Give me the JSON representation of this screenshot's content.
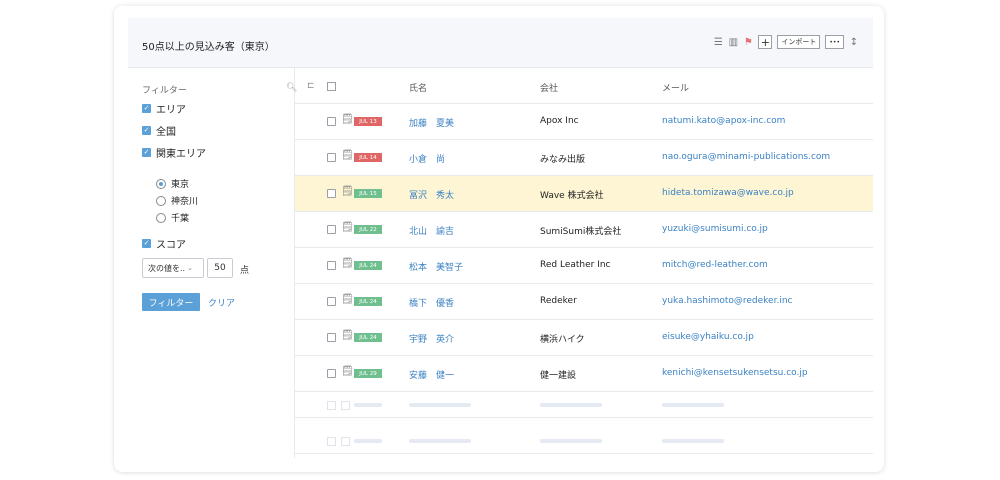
{
  "header": {
    "title": "50点以上の見込み客（東京）",
    "import_label": "インポート",
    "more_label": "•••",
    "add_label": "+",
    "sort_label": "↕"
  },
  "sidebar": {
    "title": "フィルター",
    "checkboxes": [
      "エリア",
      "全国",
      "関東エリア"
    ],
    "radios": [
      {
        "label": "東京",
        "selected": true
      },
      {
        "label": "神奈川",
        "selected": false
      },
      {
        "label": "千葉",
        "selected": false
      }
    ],
    "score_label": "スコア",
    "select_value": "次の値を..",
    "score_value": "50",
    "score_unit": "点",
    "filter_button": "フィルター",
    "clear_link": "クリア"
  },
  "table": {
    "columns": {
      "name": "氏名",
      "company": "会社",
      "email": "メール"
    },
    "rows": [
      {
        "tag": "JUL 13",
        "tag_color": "red",
        "name": "加藤　夏美",
        "company": "Apox Inc",
        "email": "natumi.kato@apox-inc.com"
      },
      {
        "tag": "JUL 14",
        "tag_color": "red",
        "name": "小倉　尚",
        "company": "みなみ出版",
        "email": "nao.ogura@minami-publications.com"
      },
      {
        "tag": "JUL 15",
        "tag_color": "green",
        "name": "冨沢　秀太",
        "company": "Wave 株式会社",
        "email": "hideta.tomizawa@wave.co.jp"
      },
      {
        "tag": "JUL 22",
        "tag_color": "green",
        "name": "北山　諭吉",
        "company": "SumiSumi株式会社",
        "email": "yuzuki@sumisumi.co.jp"
      },
      {
        "tag": "JUL 24",
        "tag_color": "green",
        "name": "松本　美智子",
        "company": "Red Leather Inc",
        "email": "mitch@red-leather.com"
      },
      {
        "tag": "JUL 24",
        "tag_color": "green",
        "name": "橋下　優香",
        "company": "Redeker",
        "email": "yuka.hashimoto@redeker.inc"
      },
      {
        "tag": "JUL 24",
        "tag_color": "green",
        "name": "宇野　英介",
        "company": "横浜ハイク",
        "email": "eisuke@yhaiku.co.jp"
      },
      {
        "tag": "JUL 29",
        "tag_color": "green",
        "name": "安藤　健一",
        "company": "健一建設",
        "email": "kenichi@kensetsukensetsu.co.jp"
      }
    ],
    "highlight_row": 2
  },
  "colors": {
    "accent": "#5ba0d6",
    "link": "#3b82c4",
    "tag_red": "#e06666",
    "tag_green": "#6fbf8f",
    "highlight": "#fdf5d4"
  },
  "icons": [
    "list-view-icon",
    "column-view-icon",
    "flag-icon",
    "search-icon",
    "note-icon",
    "sort-icon"
  ]
}
